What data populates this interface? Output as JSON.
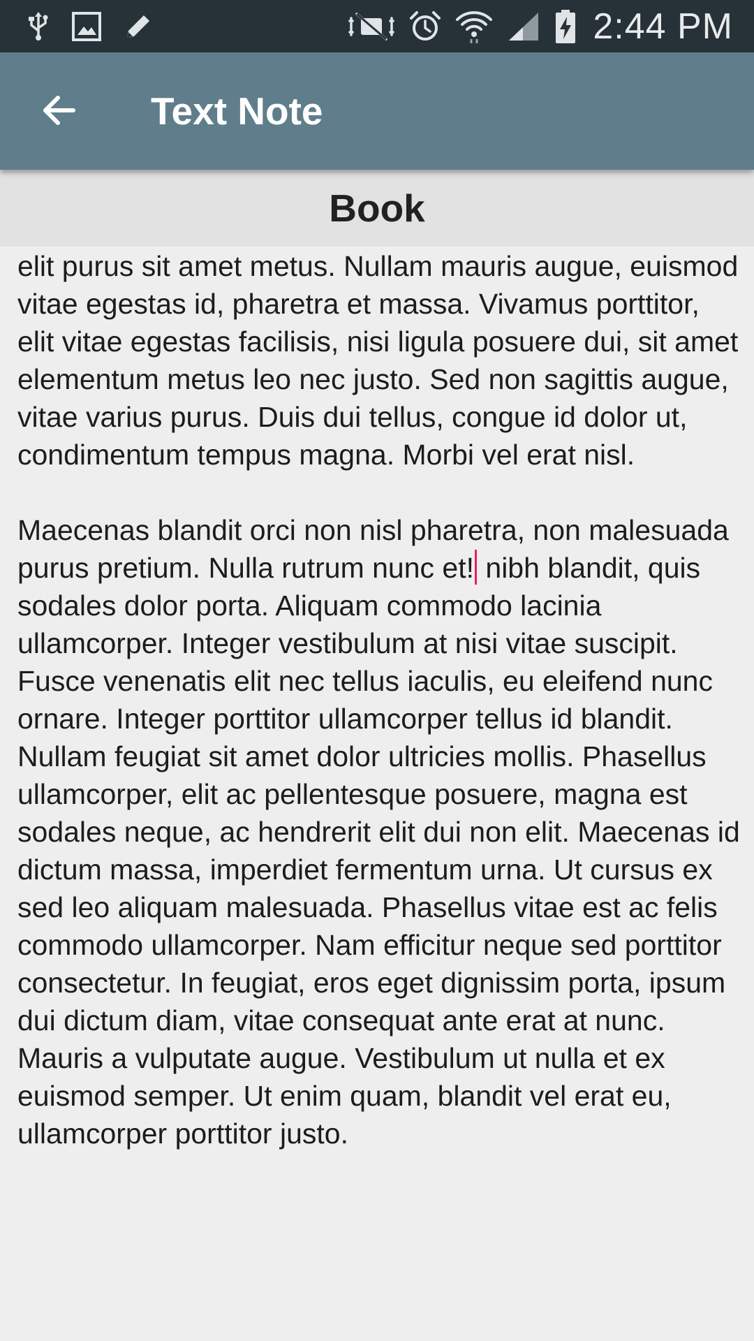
{
  "status_bar": {
    "time": "2:44 PM",
    "left_icons": [
      "usb-icon",
      "image-icon",
      "pencil-icon"
    ],
    "right_icons": [
      "mute-icon",
      "alarm-icon",
      "wifi-icon",
      "signal-icon",
      "battery-charging-icon"
    ]
  },
  "app_bar": {
    "title": "Text Note",
    "back_icon": "arrow-back-icon",
    "color": "#607d8b"
  },
  "note": {
    "title": "Book",
    "paragraph_1": "ultrices viverra, ipsum libero semper urna, id vulputate elit purus sit amet metus. Nullam mauris augue, euismod vitae egestas id, pharetra et massa. Vivamus porttitor, elit vitae egestas facilisis, nisi ligula posuere dui, sit amet elementum metus leo nec justo. Sed non sagittis augue, vitae varius purus. Duis dui tellus, congue id dolor ut, condimentum tempus magna. Morbi vel erat nisl.",
    "paragraph_2_before_cursor": "Maecenas blandit orci non nisl pharetra, non malesuada purus pretium. Nulla rutrum nunc et!",
    "paragraph_2_after_cursor": " nibh blandit, quis sodales dolor porta. Aliquam commodo lacinia ullamcorper. Integer vestibulum at nisi vitae suscipit. Fusce venenatis elit nec tellus iaculis, eu eleifend nunc ornare. Integer porttitor ullamcorper tellus id blandit. Nullam feugiat sit amet dolor ultricies mollis. Phasellus ullamcorper, elit ac pellentesque posuere, magna est sodales neque, ac hendrerit elit dui non elit. Maecenas id dictum massa, imperdiet fermentum urna. Ut cursus ex sed leo aliquam malesuada. Phasellus vitae est ac felis commodo ullamcorper. Nam efficitur neque sed porttitor consectetur. In feugiat, eros eget dignissim porta, ipsum dui dictum diam, vitae consequat ante erat at nunc. Mauris a vulputate augue. Vestibulum ut nulla et ex euismod semper. Ut enim quam, blandit vel erat eu, ullamcorper porttitor justo.",
    "cursor_color": "#e91e63"
  }
}
